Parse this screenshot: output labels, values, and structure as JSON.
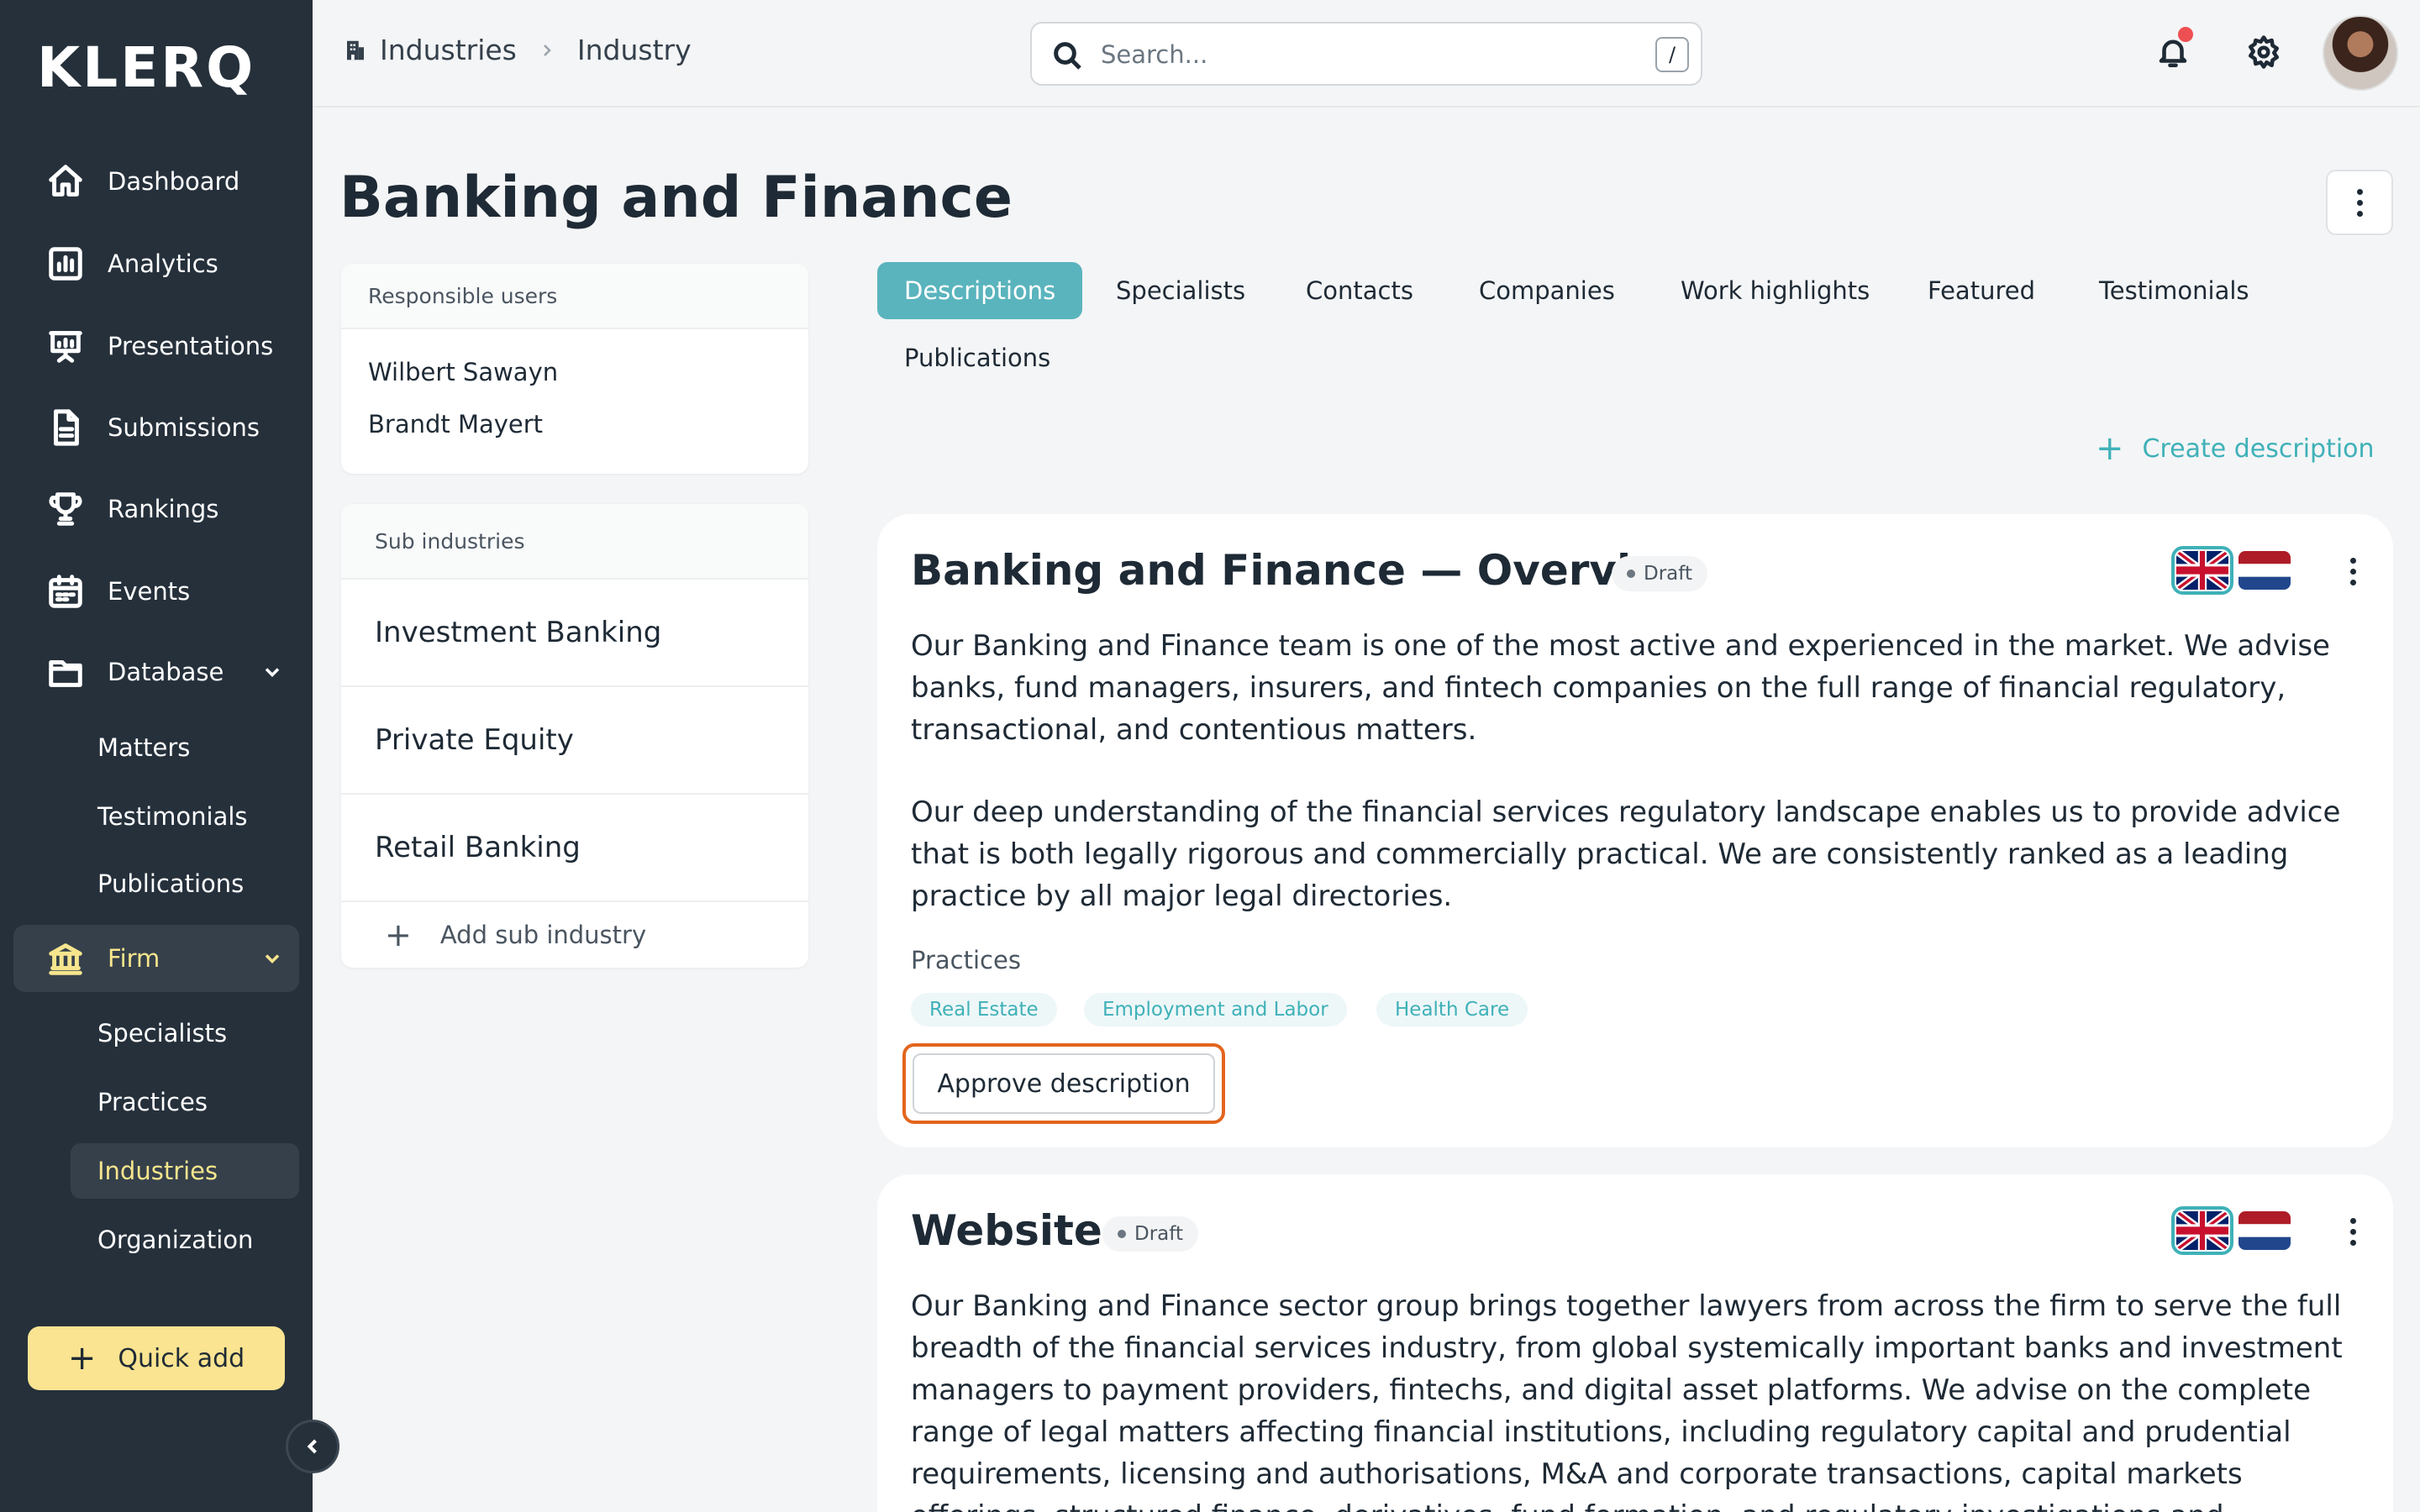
{
  "app": {
    "logo": "KLERQ"
  },
  "sidebar": {
    "items": [
      {
        "label": "Dashboard",
        "icon": "home-icon"
      },
      {
        "label": "Analytics",
        "icon": "analytics-icon"
      },
      {
        "label": "Presentations",
        "icon": "presentation-icon"
      },
      {
        "label": "Submissions",
        "icon": "document-icon"
      },
      {
        "label": "Rankings",
        "icon": "trophy-icon"
      },
      {
        "label": "Events",
        "icon": "calendar-icon"
      },
      {
        "label": "Database",
        "icon": "folder-icon",
        "expanded": true
      },
      {
        "label": "Firm",
        "icon": "bank-icon",
        "expanded": true,
        "active": true
      }
    ],
    "database_sub": [
      "Matters",
      "Testimonials",
      "Publications"
    ],
    "firm_sub": [
      "Specialists",
      "Practices",
      "Industries",
      "Organization"
    ],
    "active_sub": "Industries",
    "quick_add": "Quick add"
  },
  "breadcrumb": {
    "parent": "Industries",
    "current": "Industry"
  },
  "search": {
    "placeholder": "Search...",
    "shortcut": "/"
  },
  "page": {
    "title": "Banking and Finance"
  },
  "responsible_users": {
    "header": "Responsible users",
    "users": [
      "Wilbert Sawayn",
      "Brandt Mayert"
    ]
  },
  "sub_industries": {
    "header": "Sub industries",
    "items": [
      "Investment Banking",
      "Private Equity",
      "Retail Banking"
    ],
    "add_label": "Add sub industry"
  },
  "tabs": {
    "items": [
      "Descriptions",
      "Specialists",
      "Contacts",
      "Companies",
      "Work highlights",
      "Featured",
      "Testimonials",
      "Publications"
    ],
    "active": "Descriptions"
  },
  "create_description": "Create description",
  "cards": [
    {
      "title": "Banking and Finance — Overview",
      "status": "Draft",
      "paragraphs": [
        "Our Banking and Finance team is one of the most active and experienced in the market. We advise banks, fund managers, insurers, and fintech companies on the full range of financial regulatory, transactional, and contentious matters.",
        "Our deep understanding of the financial services regulatory landscape enables us to provide advice that is both legally rigorous and commercially practical. We are consistently ranked as a leading practice by all major legal directories."
      ],
      "practices_label": "Practices",
      "practices": [
        "Real Estate",
        "Employment and Labor",
        "Health Care"
      ],
      "approve_label": "Approve description"
    },
    {
      "title": "Website",
      "status": "Draft",
      "paragraphs": [
        "Our Banking and Finance sector group brings together lawyers from across the firm to serve the full breadth of the financial services industry, from global systemically important banks and investment managers to payment providers, fintechs, and digital asset platforms. We advise on the complete range of legal matters affecting financial institutions, including regulatory capital and prudential requirements, licensing and authorisations, M&A and corporate transactions, capital markets offerings, structured finance, derivatives, fund formation, and regulatory investigations and enforcement. Our team has a deep understanding of the"
      ]
    }
  ],
  "colors": {
    "sidebar_bg": "#25303b",
    "accent": "#5ab4bd",
    "highlight": "#f6e58d",
    "quick_add_bg": "#fbe491",
    "focus_ring": "#e3651d"
  },
  "languages": [
    "en",
    "nl"
  ]
}
